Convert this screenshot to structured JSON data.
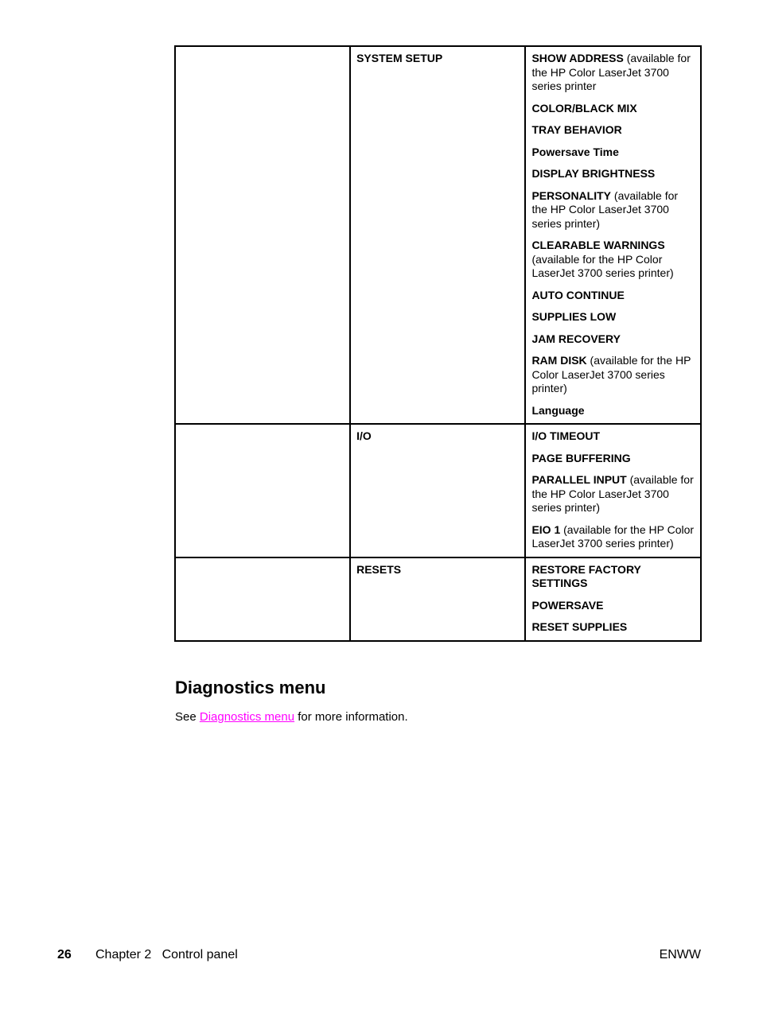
{
  "table": {
    "rows": [
      {
        "submenu": "SYSTEM SETUP",
        "items": [
          {
            "name": "SHOW ADDRESS",
            "note": " (available for the HP Color LaserJet 3700 series printer"
          },
          {
            "name": "COLOR/BLACK MIX",
            "note": ""
          },
          {
            "name": "TRAY BEHAVIOR",
            "note": ""
          },
          {
            "name": "Powersave Time",
            "note": ""
          },
          {
            "name": "DISPLAY BRIGHTNESS",
            "note": ""
          },
          {
            "name": "PERSONALITY",
            "note": " (available for the HP Color LaserJet 3700 series printer)"
          },
          {
            "name": "CLEARABLE WARNINGS",
            "note": " (available for the HP Color LaserJet 3700 series printer)"
          },
          {
            "name": "AUTO CONTINUE",
            "note": ""
          },
          {
            "name": "SUPPLIES LOW",
            "note": ""
          },
          {
            "name": "JAM RECOVERY",
            "note": ""
          },
          {
            "name": "RAM DISK",
            "note": " (available for the HP Color LaserJet 3700 series printer)"
          },
          {
            "name": "Language",
            "note": ""
          }
        ]
      },
      {
        "submenu": "I/O",
        "items": [
          {
            "name": "I/O TIMEOUT",
            "note": ""
          },
          {
            "name": "PAGE BUFFERING",
            "note": ""
          },
          {
            "name": "PARALLEL INPUT",
            "note": " (available for the HP Color LaserJet 3700 series printer)"
          },
          {
            "name": "EIO 1",
            "note": " (available for the HP Color LaserJet 3700 series printer)"
          }
        ]
      },
      {
        "submenu": "RESETS",
        "items": [
          {
            "name": "RESTORE FACTORY SETTINGS",
            "note": ""
          },
          {
            "name": "POWERSAVE",
            "note": ""
          },
          {
            "name": "RESET SUPPLIES",
            "note": ""
          }
        ]
      }
    ]
  },
  "section": {
    "heading": "Diagnostics menu",
    "text_before": "See ",
    "link_text": "Diagnostics menu",
    "text_after": " for more information.",
    "link_color": "#ff00ff"
  },
  "footer": {
    "page_number": "26",
    "chapter": "Chapter 2   Control panel",
    "right": "ENWW"
  }
}
